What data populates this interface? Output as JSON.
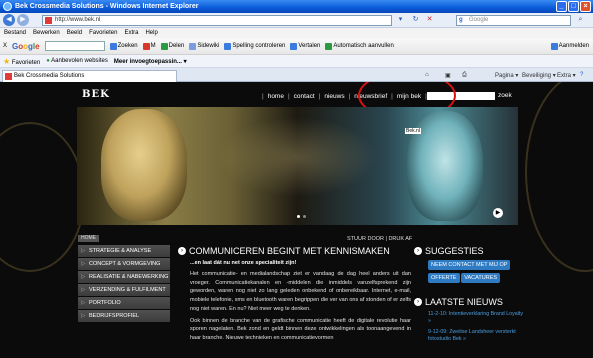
{
  "window": {
    "title": "Bek Crossmedia Solutions - Windows Internet Explorer"
  },
  "address": {
    "url": "http://www.bek.nl",
    "search_placeholder": "Google"
  },
  "menubar": [
    "Bestand",
    "Bewerken",
    "Beeld",
    "Favorieten",
    "Extra",
    "Help"
  ],
  "toolbar": {
    "google_x": "X",
    "zoeken": "Zoeken",
    "delen": "Delen",
    "sidewiki": "Sidewiki",
    "spelling": "Spelling controleren",
    "vertalen": "Vertalen",
    "automatisch": "Automatisch aanvullen",
    "aanmelden": "Aanmelden"
  },
  "favorites": {
    "label": "Favorieten",
    "suggested": "Aanbevolen websites",
    "meer": "Meer invoegtoepassin..."
  },
  "tab": {
    "label": "Bek Crossmedia Solutions"
  },
  "commandbar": {
    "pagina": "Pagina",
    "beveiliging": "Beveiliging",
    "extra": "Extra"
  },
  "site": {
    "logo": "BEK",
    "nav": [
      "home",
      "contact",
      "nieuws",
      "nieuwsbrief",
      "mijn bek"
    ],
    "search_button": "zoek",
    "hero_tag": "Bek.nl",
    "breadcrumb": "HOME",
    "stuur": "STUUR DOOR | DRUK AF",
    "sidemenu": [
      "STRATEGIE & ANALYSE",
      "CONCEPT & VORMGEVING",
      "REALISATIE & NABEWERKING",
      "VERZENDING & FULFILMENT",
      "PORTFOLIO",
      "BEDRIJFSPROFIEL"
    ],
    "main": {
      "heading": "COMMUNICEREN BEGINT MET KENNISMAKEN",
      "subheading": "...en laat dát nu net onze specialiteit zijn!",
      "para1": "Het communicatie- en medialandschap ziet er vandaag de dag heel anders uit dan vroeger. Communicatiekanalen en -middelen die inmiddels vanzelfsprekend zijn geworden, waren nog niet zo lang geleden onbekend of onbereikbaar. Internet, e-mail, mobiele telefonie, sms en bluetooth waren begrippen die ver van ons af stonden of er zelfs nog niet waren. En nu? Niet meer weg te denken.",
      "para2": "Ook binnen de branche van de grafische communicatie heeft de digitale revolutie haar sporen nagelaten. Bek zond en geldt binnen deze ontwikkelingen als toonaangevend in haar branche. Nieuwe technieken en communicatievormen"
    },
    "suggesties": {
      "heading": "SUGGESTIES",
      "contact": "NEEM CONTACT MET MIJ OP",
      "offerte": "OFFERTE",
      "vacatures": "VACATURES"
    },
    "nieuws": {
      "heading": "LAATSTE NIEUWS",
      "items": [
        "11-2-10: Intentieverklaring Brand Loyalty »",
        "9-12-09: Zweitse Landsheer versterkt fotostudio Bek »"
      ]
    }
  }
}
